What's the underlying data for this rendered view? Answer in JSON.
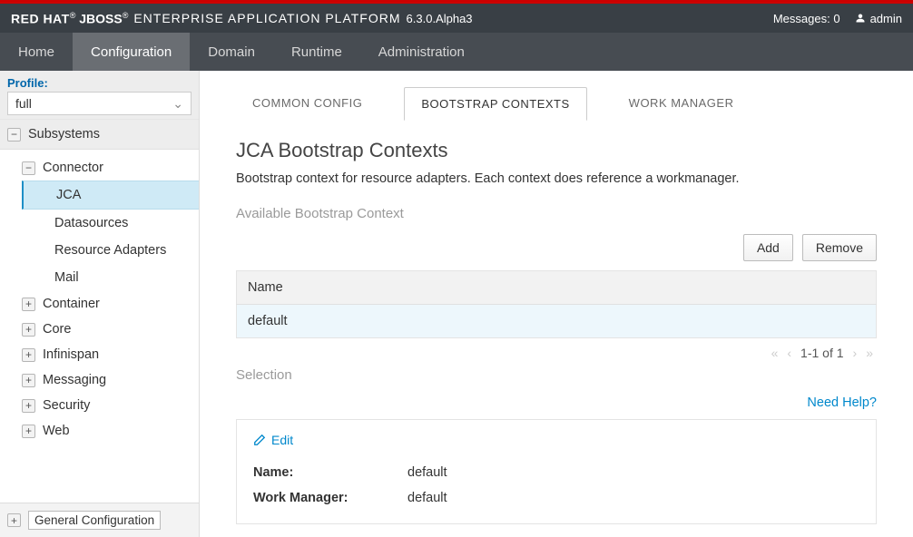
{
  "header": {
    "brand_redhat": "RED HAT",
    "brand_jboss": "JBOSS",
    "brand_suffix": "ENTERPRISE APPLICATION PLATFORM",
    "version": "6.3.0.Alpha3",
    "messages_label": "Messages:",
    "messages_count": "0",
    "user": "admin"
  },
  "nav": {
    "items": [
      "Home",
      "Configuration",
      "Domain",
      "Runtime",
      "Administration"
    ],
    "active": "Configuration"
  },
  "sidebar": {
    "profile_label": "Profile:",
    "profile_value": "full",
    "subsystems_label": "Subsystems",
    "connector": {
      "label": "Connector",
      "items": [
        "JCA",
        "Datasources",
        "Resource Adapters",
        "Mail"
      ],
      "selected": "JCA"
    },
    "groups": [
      "Container",
      "Core",
      "Infinispan",
      "Messaging",
      "Security",
      "Web"
    ],
    "general_conf": "General Configuration"
  },
  "tabs": {
    "items": [
      "COMMON CONFIG",
      "BOOTSTRAP CONTEXTS",
      "WORK MANAGER"
    ],
    "active": "BOOTSTRAP CONTEXTS"
  },
  "page": {
    "title": "JCA Bootstrap Contexts",
    "description": "Bootstrap context for resource adapters. Each context does reference a workmanager.",
    "available_label": "Available Bootstrap Context",
    "add_btn": "Add",
    "remove_btn": "Remove",
    "table": {
      "col_name": "Name",
      "rows": [
        {
          "name": "default"
        }
      ]
    },
    "pager": "1-1 of 1",
    "selection_label": "Selection",
    "help_link": "Need Help?",
    "edit_label": "Edit",
    "detail": {
      "name_label": "Name:",
      "name_value": "default",
      "wm_label": "Work Manager:",
      "wm_value": "default"
    }
  }
}
